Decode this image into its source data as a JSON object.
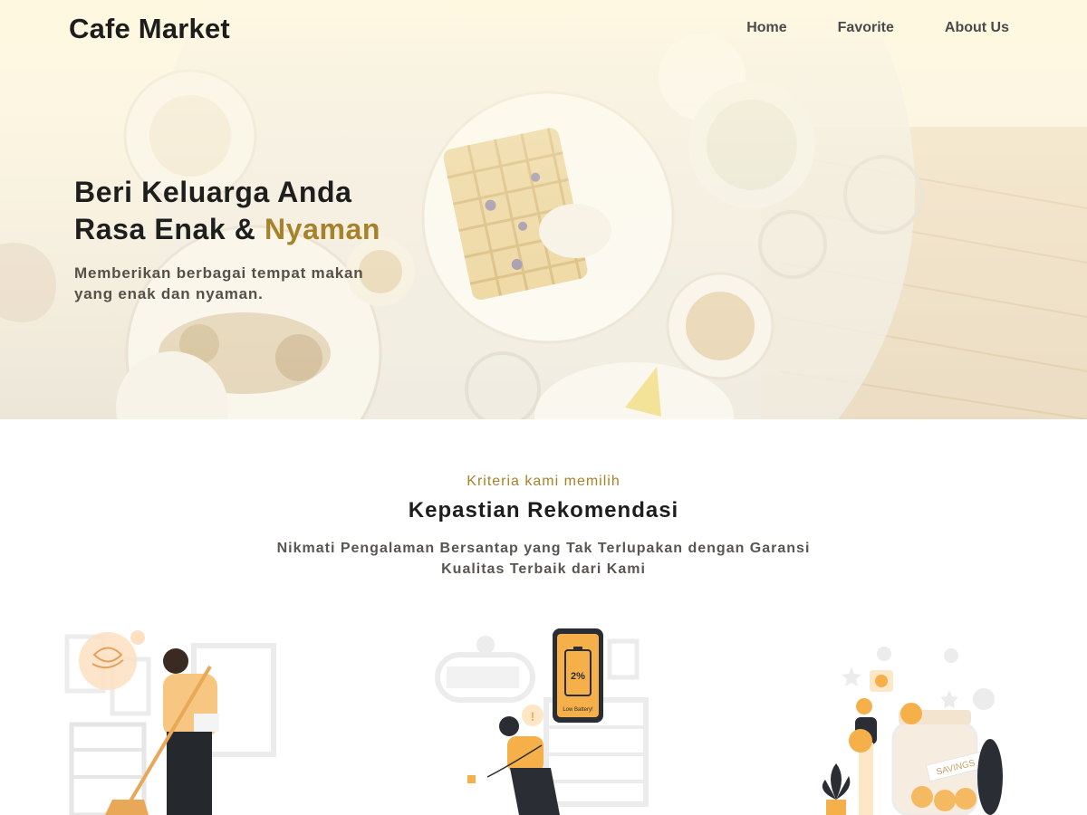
{
  "nav": {
    "brand": "Cafe Market",
    "links": [
      "Home",
      "Favorite",
      "About Us"
    ]
  },
  "hero": {
    "title_line1": "Beri Keluarga Anda",
    "title_line2_prefix": "Rasa Enak & ",
    "title_line2_accent": "Nyaman",
    "subtitle": "Memberikan berbagai tempat makan yang enak dan nyaman."
  },
  "section": {
    "eyebrow": "Kriteria kami memilih",
    "title": "Kepastian Rekomendasi",
    "description": "Nikmati Pengalaman Bersantap yang Tak Terlupakan dengan Garansi Kualitas Terbaik dari Kami"
  },
  "illustrations": {
    "battery": {
      "percent": "2%",
      "caption": "Low Battery!"
    },
    "savings": {
      "jar_label": "SAVINGS"
    }
  },
  "colors": {
    "accent": "#a8822a",
    "hero_bg": "#fff8e1",
    "illustration_orange": "#f5b04a"
  }
}
